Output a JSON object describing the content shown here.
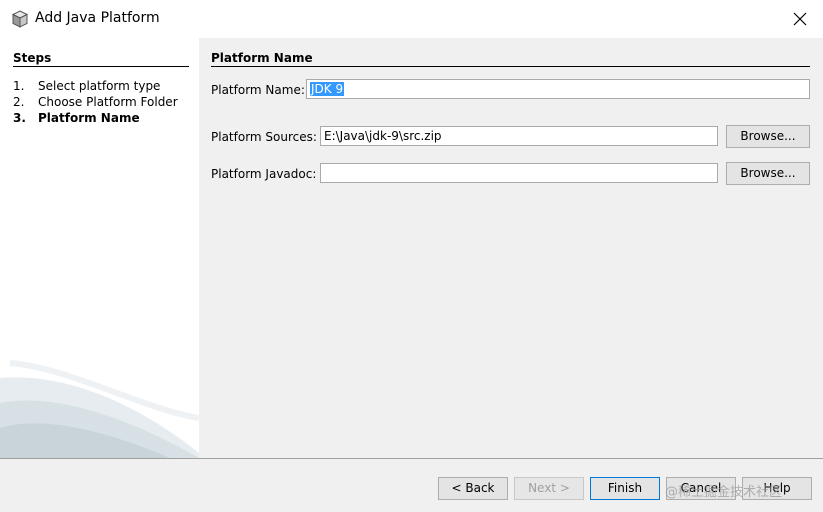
{
  "window": {
    "title": "Add Java Platform",
    "icon": "java-cube-icon",
    "close_icon": "close-icon"
  },
  "steps": {
    "title": "Steps",
    "items": [
      {
        "number": "1.",
        "label": "Select platform type"
      },
      {
        "number": "2.",
        "label": "Choose Platform Folder"
      },
      {
        "number": "3.",
        "label": "Platform Name"
      }
    ],
    "current_index": 2
  },
  "panel": {
    "title": "Platform Name",
    "platform_name": {
      "label": "Platform Name:",
      "value": "JDK 9"
    },
    "platform_sources": {
      "label": "Platform Sources:",
      "value": "E:\\Java\\jdk-9\\src.zip",
      "browse": "Browse..."
    },
    "platform_javadoc": {
      "label": "Platform Javadoc:",
      "value": "",
      "browse": "Browse..."
    }
  },
  "footer": {
    "back": "< Back",
    "next": "Next >",
    "finish": "Finish",
    "cancel": "Cancel",
    "help": "Help"
  },
  "watermark": "@稀土掘金技术社区",
  "colors": {
    "selection": "#3399ff",
    "content_bg": "#f0f0f0",
    "button_bg": "#e4e4e4"
  }
}
